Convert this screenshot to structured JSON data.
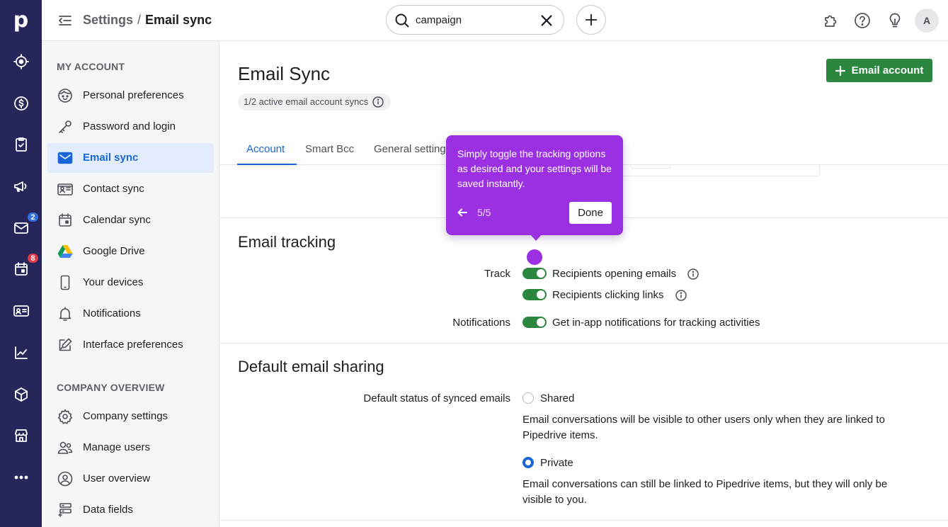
{
  "rail": {
    "logo": "p",
    "items": [
      {
        "icon": "target-icon"
      },
      {
        "icon": "dollar-icon"
      },
      {
        "icon": "clipboard-check-icon"
      },
      {
        "icon": "megaphone-icon"
      },
      {
        "icon": "mail-icon",
        "badge": "2"
      },
      {
        "icon": "calendar-icon",
        "badge": "8"
      },
      {
        "icon": "contact-card-icon"
      },
      {
        "icon": "chart-line-icon"
      },
      {
        "icon": "box-icon"
      },
      {
        "icon": "store-icon"
      },
      {
        "icon": "more-icon"
      }
    ]
  },
  "header": {
    "breadcrumb_parent": "Settings",
    "breadcrumb_sep": "/",
    "breadcrumb_current": "Email sync",
    "search_value": "campaign"
  },
  "sidebar": {
    "my_account_heading": "MY ACCOUNT",
    "company_heading": "COMPANY OVERVIEW",
    "items": [
      {
        "label": "Personal preferences"
      },
      {
        "label": "Password and login"
      },
      {
        "label": "Email sync"
      },
      {
        "label": "Contact sync"
      },
      {
        "label": "Calendar sync"
      },
      {
        "label": "Google Drive"
      },
      {
        "label": "Your devices"
      },
      {
        "label": "Notifications"
      },
      {
        "label": "Interface preferences"
      }
    ],
    "company_items": [
      {
        "label": "Company settings"
      },
      {
        "label": "Manage users"
      },
      {
        "label": "User overview"
      },
      {
        "label": "Data fields"
      }
    ]
  },
  "main": {
    "title": "Email Sync",
    "sync_pill": "1/2 active email account syncs",
    "add_button": "Email account",
    "tabs": [
      {
        "label": "Account"
      },
      {
        "label": "Smart Bcc"
      },
      {
        "label": "General setting"
      }
    ],
    "tracking": {
      "title": "Email tracking",
      "track_label": "Track",
      "opt_opening": "Recipients opening emails",
      "opt_clicking": "Recipients clicking links",
      "notifications_label": "Notifications",
      "opt_notifications": "Get in-app notifications for tracking activities"
    },
    "sharing": {
      "title": "Default email sharing",
      "status_label": "Default status of synced emails",
      "shared": "Shared",
      "shared_desc": "Email conversations will be visible to other users only when they are linked to Pipedrive items.",
      "private": "Private",
      "private_desc": "Email conversations can still be linked to Pipedrive items, but they will only be visible to you."
    }
  },
  "tour": {
    "text": "Simply toggle the tracking options as desired and your settings will be saved instantly.",
    "step": "5/5",
    "done": "Done"
  },
  "colors": {
    "rail": "#26265a",
    "accent_blue": "#1966d6",
    "primary_green": "#2b8740",
    "tour_purple": "#9b30e3"
  }
}
